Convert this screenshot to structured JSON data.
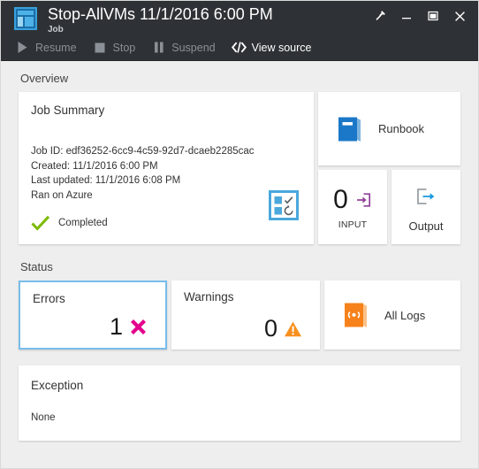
{
  "window": {
    "title": "Stop-AllVMs 11/1/2016 6:00 PM",
    "subtitle": "Job",
    "controls": {
      "pin": "pin-icon",
      "minimize": "minimize-icon",
      "maximize": "maximize-icon",
      "close": "close-icon"
    },
    "app_icon": "job-blade-icon"
  },
  "toolbar": {
    "items": [
      {
        "label": "Resume",
        "icon": "play-icon",
        "enabled": false
      },
      {
        "label": "Stop",
        "icon": "stop-square-icon",
        "enabled": false
      },
      {
        "label": "Suspend",
        "icon": "pause-icon",
        "enabled": false
      },
      {
        "label": "View source",
        "icon": "code-brackets-icon",
        "enabled": true
      }
    ]
  },
  "overview": {
    "label": "Overview",
    "job_summary": {
      "title": "Job Summary",
      "job_id_line": "Job ID: edf36252-6cc9-4c59-92d7-dcaeb2285cac",
      "created_line": "Created: 11/1/2016 6:00 PM",
      "last_updated_line": "Last updated: 11/1/2016 6:08 PM",
      "ran_on_line": "Ran on Azure",
      "status_text": "Completed",
      "status_icon": "green-check-icon",
      "tile_icon": "checklist-icon"
    },
    "runbook": {
      "label": "Runbook",
      "icon": "blue-book-icon"
    },
    "input": {
      "count": "0",
      "label": "INPUT",
      "icon": "arrow-into-box-icon"
    },
    "output": {
      "label": "Output",
      "icon": "arrow-out-of-box-icon"
    }
  },
  "status": {
    "label": "Status",
    "errors": {
      "title": "Errors",
      "count": "1",
      "icon": "magenta-x-icon",
      "selected": true
    },
    "warnings": {
      "title": "Warnings",
      "count": "0",
      "icon": "orange-warning-triangle-icon",
      "selected": false
    },
    "all_logs": {
      "label": "All Logs",
      "icon": "orange-logs-book-icon"
    }
  },
  "exception": {
    "title": "Exception",
    "value": "None"
  },
  "colors": {
    "chrome": "#2e3236",
    "page_bg": "#eeeeee",
    "accent_blue": "#0078d7",
    "selected_border": "#79bdea",
    "error_magenta": "#e3008c",
    "warning_orange": "#f7901e",
    "success_green": "#7cba00",
    "logs_orange": "#f7821b",
    "input_purple": "#8f3f97"
  }
}
